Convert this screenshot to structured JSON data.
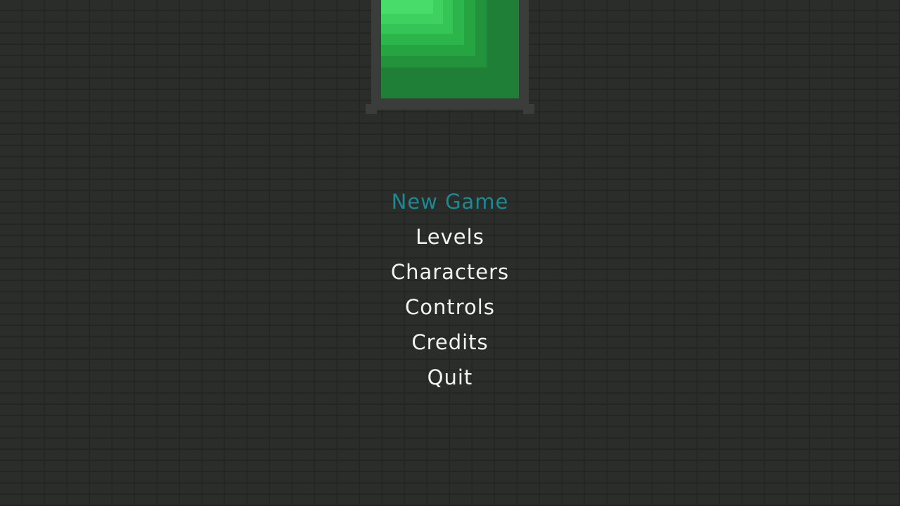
{
  "banner": {
    "frame_color": "#3b3d3b",
    "panel_colors": [
      "#1f7f36",
      "#22923c",
      "#26a442",
      "#2cb54a",
      "#35c456",
      "#3fd160",
      "#48dc6a"
    ]
  },
  "menu": {
    "items": [
      {
        "label": "New Game",
        "selected": true
      },
      {
        "label": "Levels",
        "selected": false
      },
      {
        "label": "Characters",
        "selected": false
      },
      {
        "label": "Controls",
        "selected": false
      },
      {
        "label": "Credits",
        "selected": false
      },
      {
        "label": "Quit",
        "selected": false
      }
    ],
    "selected_color": "#1c8a93",
    "text_color": "#f4f4f4"
  },
  "background": {
    "color": "#2a2d2a",
    "pattern": "brick"
  }
}
